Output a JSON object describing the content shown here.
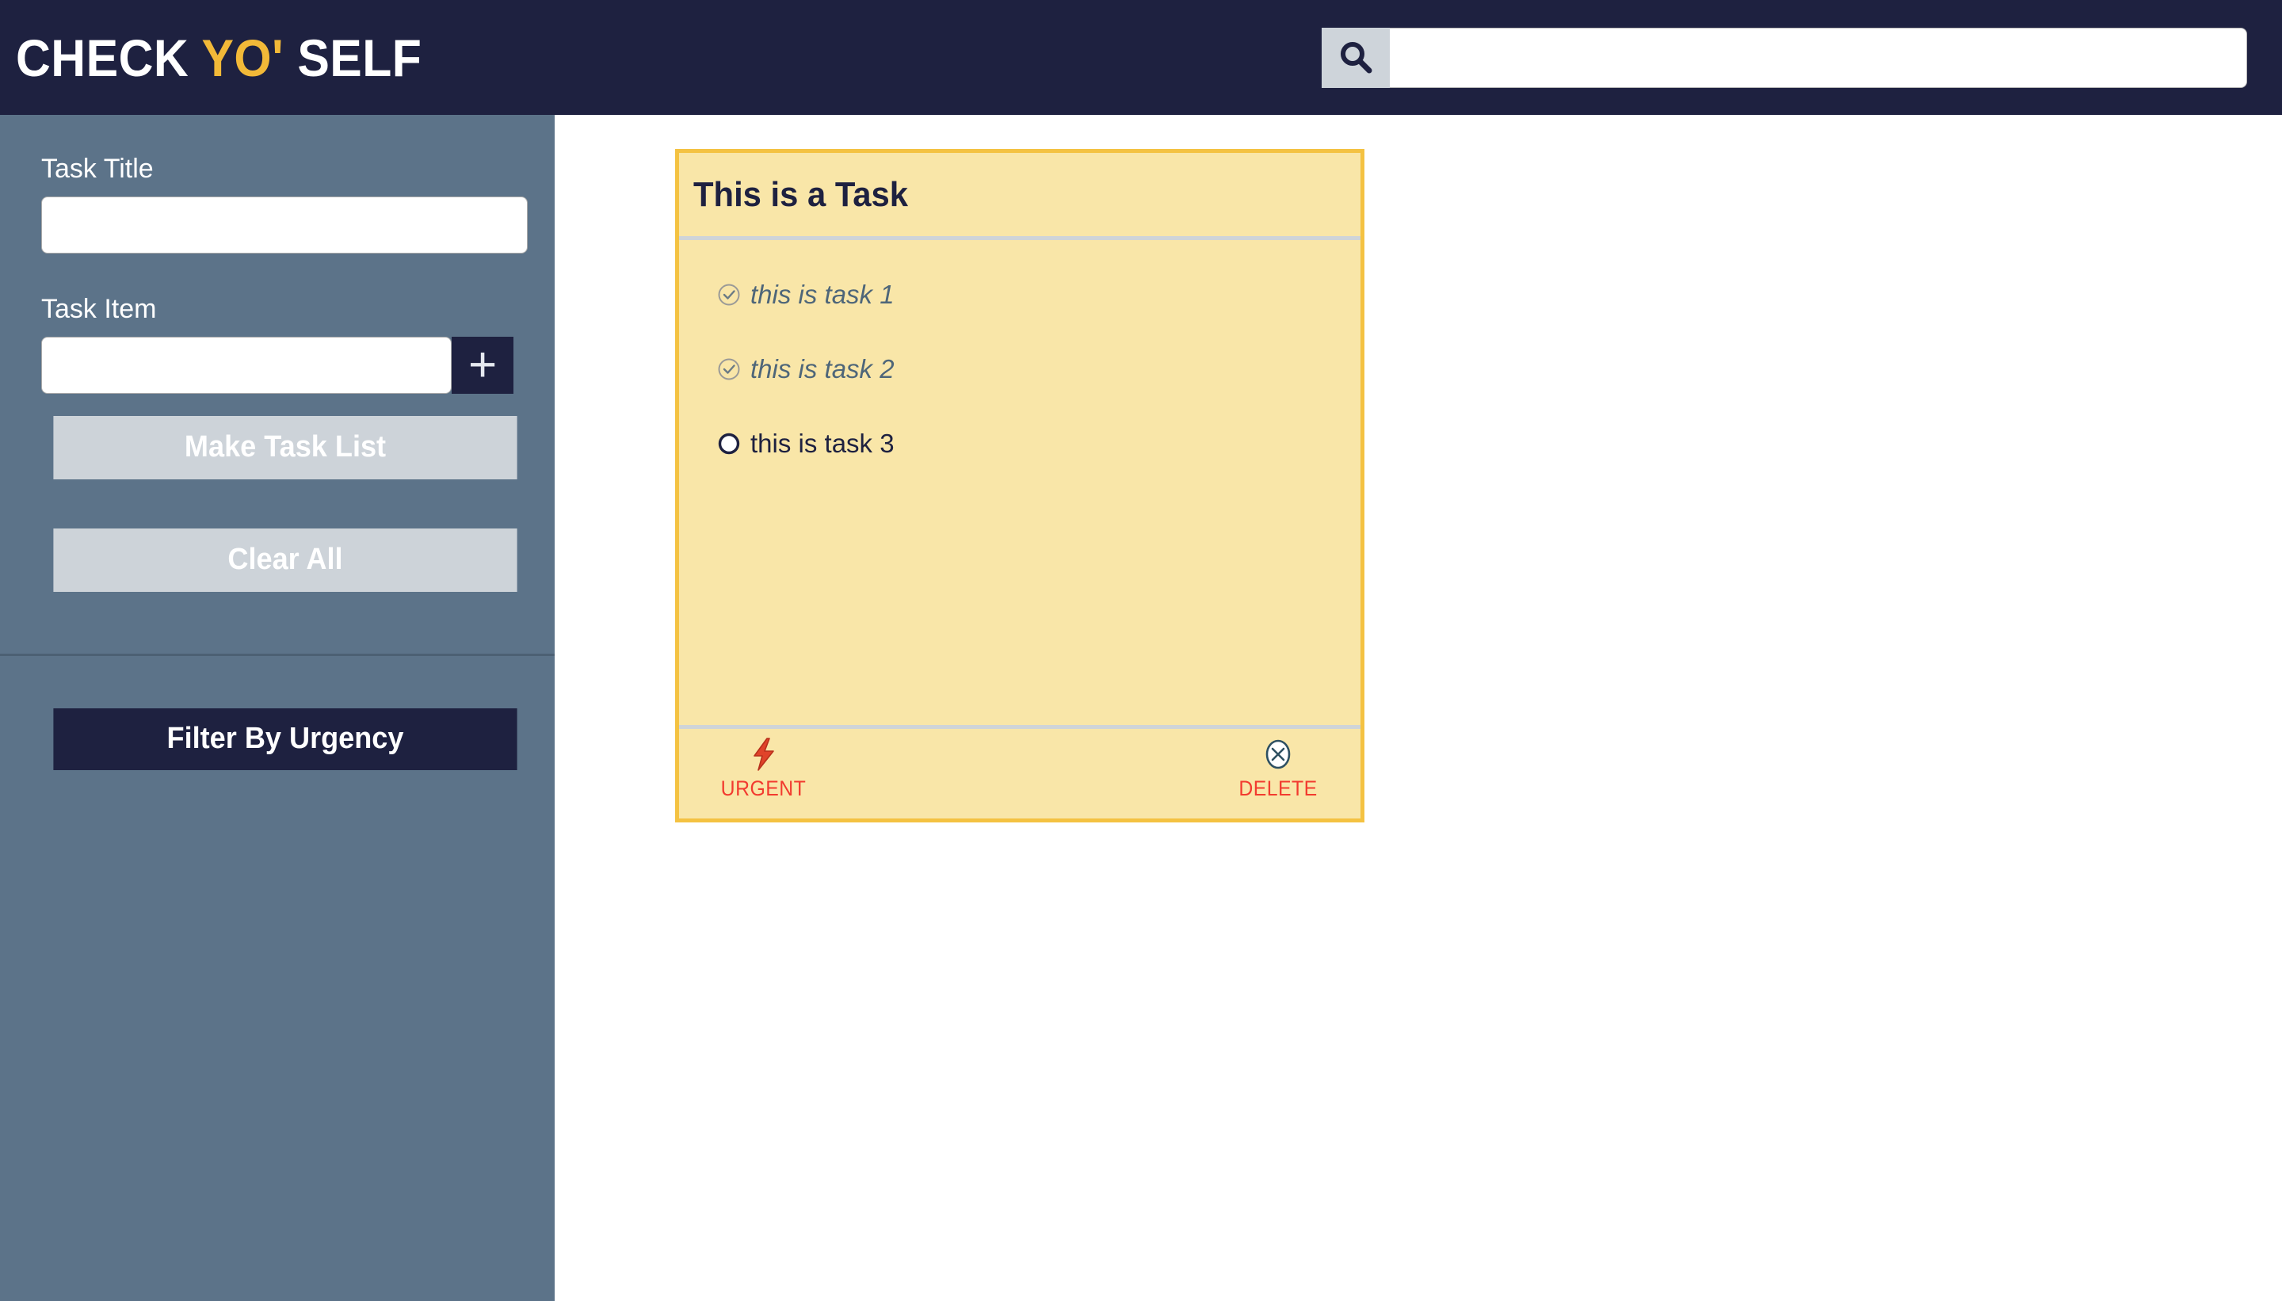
{
  "header": {
    "brand_part1": "CHECK ",
    "brand_accent": "YO'",
    "brand_part2": " SELF",
    "search": {
      "icon": "search-icon",
      "value": "",
      "placeholder": ""
    }
  },
  "sidebar": {
    "task_title_label": "Task Title",
    "task_title_value": "",
    "task_title_placeholder": "",
    "task_item_label": "Task Item",
    "task_item_value": "",
    "task_item_placeholder": "",
    "add_item_icon": "plus-icon",
    "add_item_glyph": "+",
    "make_list_label": "Make Task List",
    "clear_all_label": "Clear All",
    "filter_urgency_label": "Filter By Urgency"
  },
  "main": {
    "card": {
      "title": "This is a Task",
      "items": [
        {
          "text": "this is task 1",
          "completed": true
        },
        {
          "text": "this is task 2",
          "completed": true
        },
        {
          "text": "this is task 3",
          "completed": false
        }
      ],
      "urgent_label": "URGENT",
      "urgent_icon": "lightning-bolt-icon",
      "urgent_glyph": "⚡",
      "delete_label": "DELETE",
      "delete_icon": "circle-x-icon"
    }
  },
  "colors": {
    "header_bg": "#1E2140",
    "accent_yellow": "#F2B938",
    "sidebar_bg": "#5C7389",
    "card_bg": "#F9E6A8",
    "card_border": "#F4C242",
    "disabled_btn": "#CDD3D9",
    "danger_red": "#F23B2F",
    "done_text": "#4E6679"
  }
}
